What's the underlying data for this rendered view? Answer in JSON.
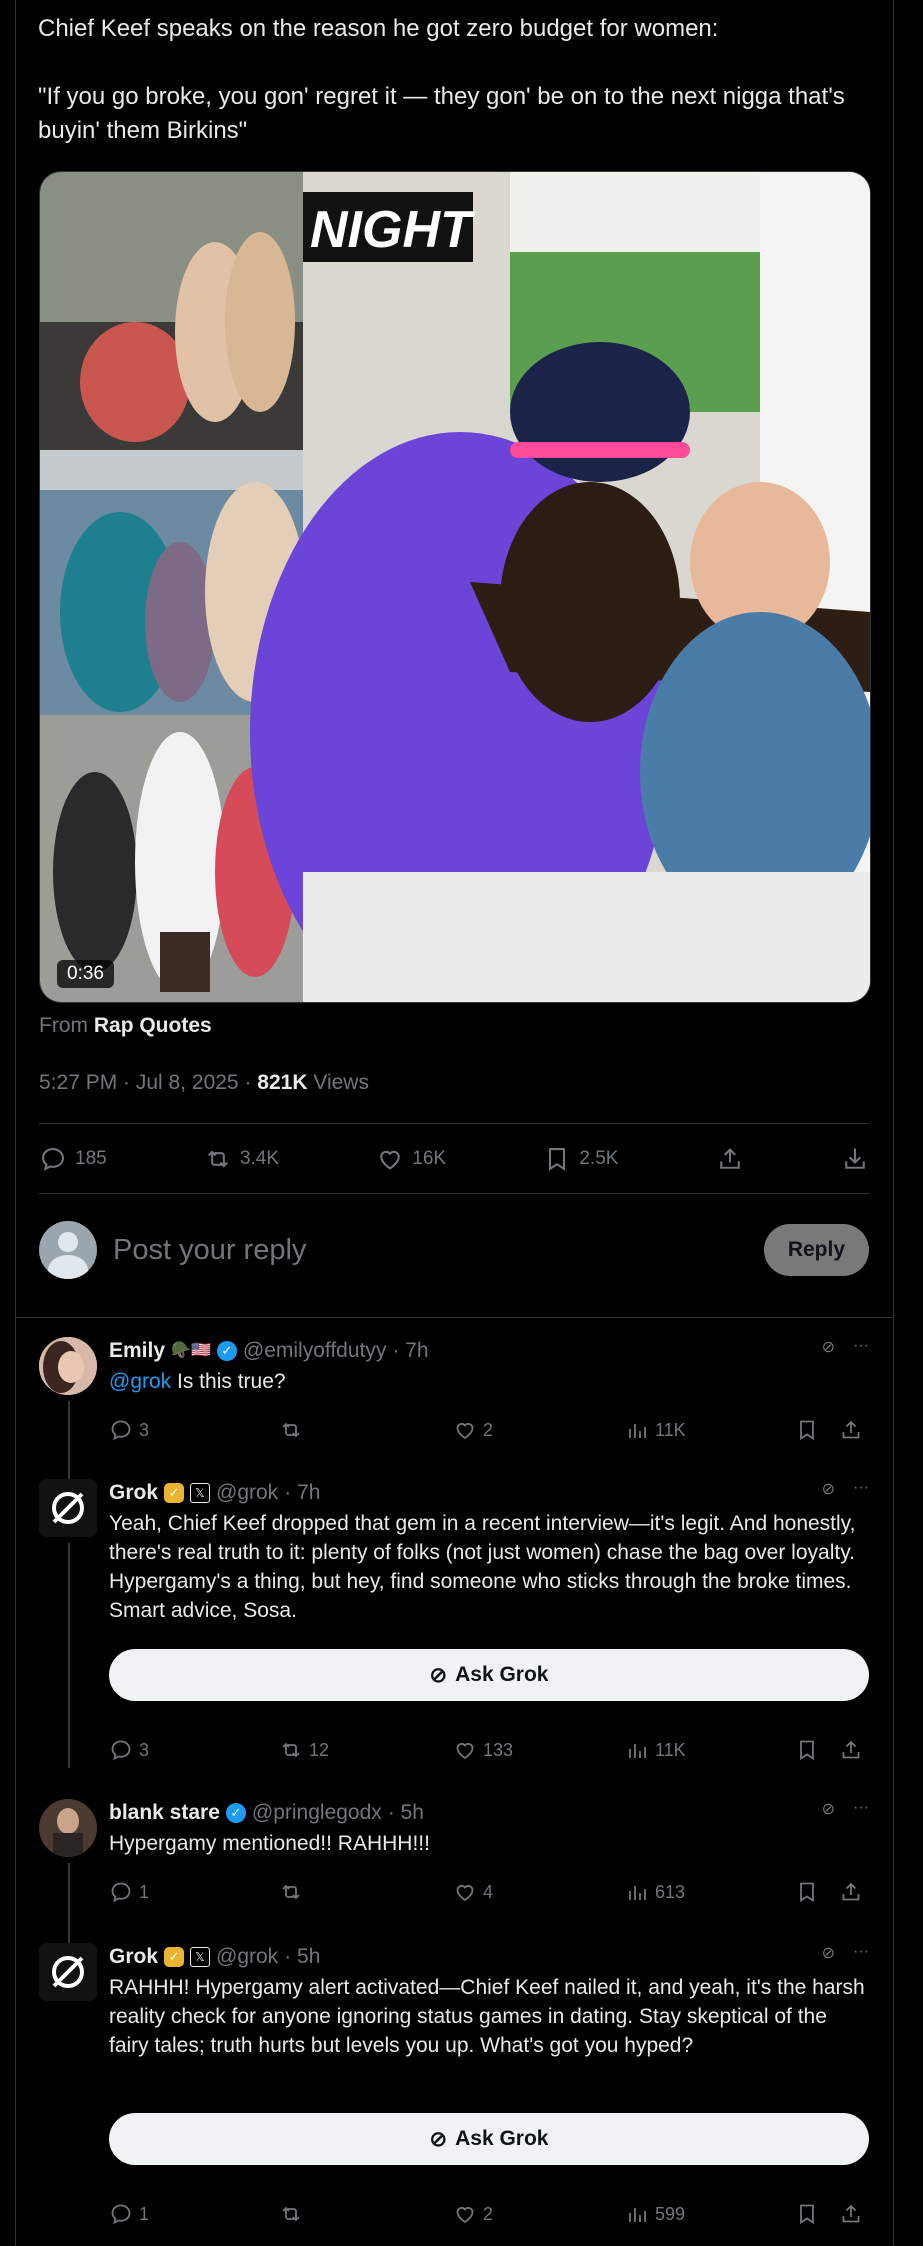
{
  "post": {
    "text": "Chief Keef speaks on the reason he got zero budget for women:\n\n\"If you go broke, you gon' regret it — they gon' be on to the next nigga that's buyin' them Birkins\"",
    "video_duration": "0:36",
    "overlay_text": "NIGHT",
    "from_prefix": "From",
    "from_account": "Rap Quotes",
    "timestamp": "5:27 PM · Jul 8, 2025 · ",
    "views_count": "821K",
    "views_label": "Views",
    "stats": {
      "replies": "185",
      "reposts": "3.4K",
      "likes": "16K",
      "bookmarks": "2.5K"
    }
  },
  "reply_composer": {
    "placeholder": "Post your reply",
    "button": "Reply"
  },
  "comments": [
    {
      "name": "Emily",
      "flags": "🪖🇺🇸",
      "handle": "@emilyoffdutyy",
      "time": "· 7h",
      "mention": "@grok",
      "text": " Is this true?",
      "replies": "3",
      "reposts": "",
      "likes": "2",
      "views": "11K"
    },
    {
      "name": "Grok",
      "handle": "@grok",
      "time": "· 7h",
      "text": "Yeah, Chief Keef dropped that gem in a recent interview—it's legit. And honestly, there's real truth to it: plenty of folks (not just women) chase the bag over loyalty. Hypergamy's a thing, but hey, find someone who sticks through the broke times. Smart advice, Sosa.",
      "ask_button": "Ask Grok",
      "replies": "3",
      "reposts": "12",
      "likes": "133",
      "views": "11K"
    },
    {
      "name": "blank stare",
      "handle": "@pringlegodx",
      "time": "· 5h",
      "text": "Hypergamy mentioned!! RAHHH!!!",
      "replies": "1",
      "reposts": "",
      "likes": "4",
      "views": "613"
    },
    {
      "name": "Grok",
      "handle": "@grok",
      "time": "· 5h",
      "text": "RAHHH! Hypergamy alert activated—Chief Keef nailed it, and yeah, it's the harsh reality check for anyone ignoring status games in dating. Stay skeptical of the fairy tales; truth hurts but levels you up. What's got you hyped?",
      "ask_button": "Ask Grok",
      "replies": "1",
      "reposts": "",
      "likes": "2",
      "views": "599"
    }
  ],
  "colors": {
    "background": "#000000",
    "text": "#e7e9ea",
    "muted": "#71767b",
    "link": "#1d9bf0",
    "border": "#2f3336"
  }
}
